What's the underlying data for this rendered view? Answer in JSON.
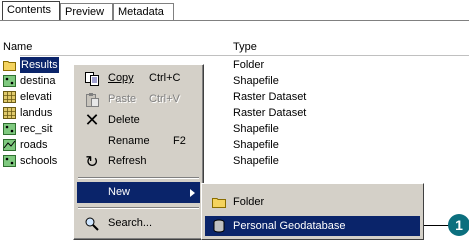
{
  "tabs": [
    {
      "label": "Contents",
      "active": true
    },
    {
      "label": "Preview",
      "active": false
    },
    {
      "label": "Metadata",
      "active": false
    }
  ],
  "columns": {
    "name": "Name",
    "type": "Type"
  },
  "rows": [
    {
      "name": "Results",
      "type": "Folder",
      "icon": "folder-icon",
      "selected": true
    },
    {
      "name": "destina",
      "type": "Shapefile",
      "icon": "shapefile-icon"
    },
    {
      "name": "elevati",
      "type": "Raster Dataset",
      "icon": "raster-icon"
    },
    {
      "name": "landus",
      "type": "Raster Dataset",
      "icon": "raster-icon"
    },
    {
      "name": "rec_sit",
      "type": "Shapefile",
      "icon": "shapefile-icon"
    },
    {
      "name": "roads",
      "type": "Shapefile",
      "icon": "line-shapefile-icon"
    },
    {
      "name": "schools",
      "type": "Shapefile",
      "icon": "shapefile-icon"
    }
  ],
  "context_menu": {
    "copy": {
      "label": "Copy",
      "shortcut": "Ctrl+C"
    },
    "paste": {
      "label": "Paste",
      "shortcut": "Ctrl+V",
      "disabled": true
    },
    "delete": {
      "label": "Delete"
    },
    "rename": {
      "label": "Rename",
      "shortcut": "F2"
    },
    "refresh": {
      "label": "Refresh"
    },
    "new": {
      "label": "New"
    },
    "search": {
      "label": "Search..."
    }
  },
  "submenu": {
    "folder": {
      "label": "Folder"
    },
    "personal_geodatabase": {
      "label": "Personal Geodatabase"
    }
  },
  "callout": {
    "number": "1"
  },
  "colors": {
    "highlight": "#0a246a",
    "menu_bg": "#d4d0c8",
    "callout": "#0b6f7e"
  }
}
